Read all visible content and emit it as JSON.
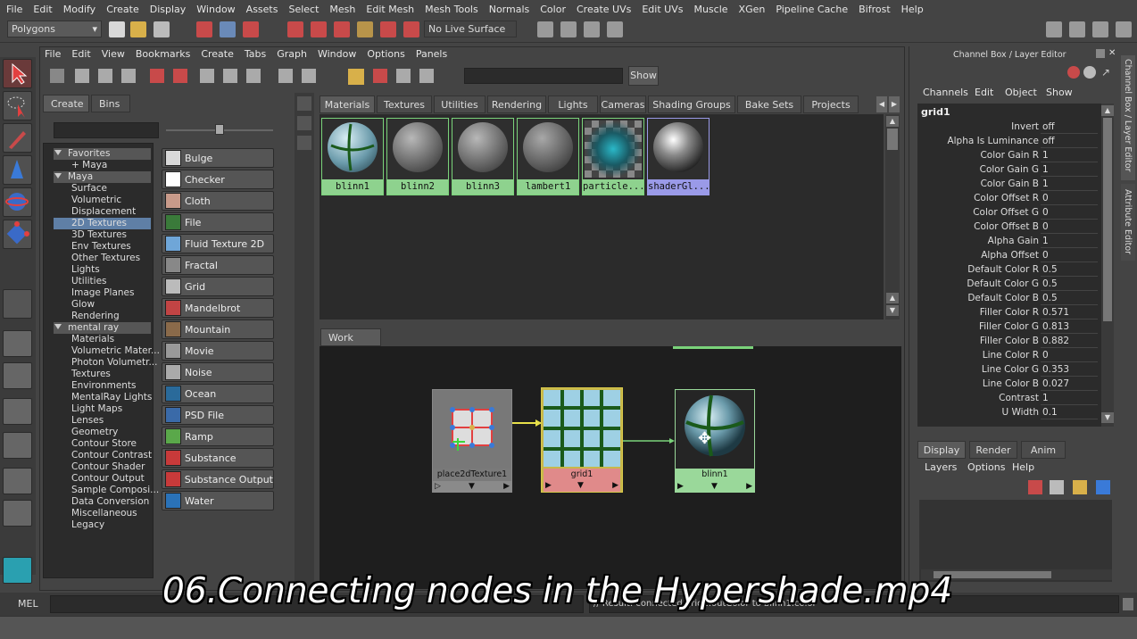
{
  "menubar": [
    "File",
    "Edit",
    "Modify",
    "Create",
    "Display",
    "Window",
    "Assets",
    "Select",
    "Mesh",
    "Edit Mesh",
    "Mesh Tools",
    "Normals",
    "Color",
    "Create UVs",
    "Edit UVs",
    "Muscle",
    "XGen",
    "Pipeline Cache",
    "Bifrost",
    "Help"
  ],
  "shelf": {
    "mode": "Polygons",
    "live_surface": "No Live Surface"
  },
  "hypershade": {
    "menu": [
      "File",
      "Edit",
      "View",
      "Bookmarks",
      "Create",
      "Tabs",
      "Graph",
      "Window",
      "Options",
      "Panels"
    ],
    "show_button": "Show",
    "left_tabs": [
      "Create",
      "Bins"
    ],
    "categories": [
      {
        "label": "Favorites",
        "kind": "h"
      },
      {
        "label": "+ Maya",
        "kind": "sub"
      },
      {
        "label": "Maya",
        "kind": "h"
      },
      {
        "label": "Surface",
        "kind": "sub"
      },
      {
        "label": "Volumetric",
        "kind": "sub"
      },
      {
        "label": "Displacement",
        "kind": "sub"
      },
      {
        "label": "2D Textures",
        "kind": "sel"
      },
      {
        "label": "3D Textures",
        "kind": "sub"
      },
      {
        "label": "Env Textures",
        "kind": "sub"
      },
      {
        "label": "Other Textures",
        "kind": "sub"
      },
      {
        "label": "Lights",
        "kind": "sub"
      },
      {
        "label": "Utilities",
        "kind": "sub"
      },
      {
        "label": "Image Planes",
        "kind": "sub"
      },
      {
        "label": "Glow",
        "kind": "sub"
      },
      {
        "label": "Rendering",
        "kind": "sub"
      },
      {
        "label": "mental ray",
        "kind": "h"
      },
      {
        "label": "Materials",
        "kind": "sub"
      },
      {
        "label": "Volumetric Mater...",
        "kind": "sub"
      },
      {
        "label": "Photon Volumetr...",
        "kind": "sub"
      },
      {
        "label": "Textures",
        "kind": "sub"
      },
      {
        "label": "Environments",
        "kind": "sub"
      },
      {
        "label": "MentalRay Lights",
        "kind": "sub"
      },
      {
        "label": "Light Maps",
        "kind": "sub"
      },
      {
        "label": "Lenses",
        "kind": "sub"
      },
      {
        "label": "Geometry",
        "kind": "sub"
      },
      {
        "label": "Contour Store",
        "kind": "sub"
      },
      {
        "label": "Contour Contrast",
        "kind": "sub"
      },
      {
        "label": "Contour Shader",
        "kind": "sub"
      },
      {
        "label": "Contour Output",
        "kind": "sub"
      },
      {
        "label": "Sample Composi...",
        "kind": "sub"
      },
      {
        "label": "Data Conversion",
        "kind": "sub"
      },
      {
        "label": "Miscellaneous",
        "kind": "sub"
      },
      {
        "label": "Legacy",
        "kind": "sub"
      }
    ],
    "textures": [
      {
        "label": "Bulge",
        "color": "#d8d8d8"
      },
      {
        "label": "Checker",
        "color": "#ffffff"
      },
      {
        "label": "Cloth",
        "color": "#c89a8a"
      },
      {
        "label": "File",
        "color": "#3a7a3a"
      },
      {
        "label": "Fluid Texture 2D",
        "color": "#6fa6d8"
      },
      {
        "label": "Fractal",
        "color": "#888888"
      },
      {
        "label": "Grid",
        "color": "#bbbbbb"
      },
      {
        "label": "Mandelbrot",
        "color": "#c24444"
      },
      {
        "label": "Mountain",
        "color": "#8a6a4a"
      },
      {
        "label": "Movie",
        "color": "#999999"
      },
      {
        "label": "Noise",
        "color": "#aaaaaa"
      },
      {
        "label": "Ocean",
        "color": "#2a6a9a"
      },
      {
        "label": "PSD File",
        "color": "#3a6aa8"
      },
      {
        "label": "Ramp",
        "color": "#5aa84a"
      },
      {
        "label": "Substance",
        "color": "#c83a3a"
      },
      {
        "label": "Substance Output",
        "color": "#c83a3a"
      },
      {
        "label": "Water",
        "color": "#2a72b8"
      }
    ],
    "top_tabs": [
      "Materials",
      "Textures",
      "Utilities",
      "Rendering",
      "Lights",
      "Cameras",
      "Shading Groups",
      "Bake Sets",
      "Projects"
    ],
    "swatches": [
      "blinn1",
      "blinn2",
      "blinn3",
      "lambert1",
      "particle...",
      "shaderGl..."
    ],
    "work_area_tab": "Work Area",
    "nodes": {
      "place": "place2dTexture1",
      "grid": "grid1",
      "blinn": "blinn1"
    }
  },
  "channel_box": {
    "title": "Channel Box / Layer Editor",
    "menu": [
      "Channels",
      "Edit",
      "Object",
      "Show"
    ],
    "node": "grid1",
    "attrs": [
      {
        "name": "Invert",
        "value": "off"
      },
      {
        "name": "Alpha Is Luminance",
        "value": "off"
      },
      {
        "name": "Color Gain R",
        "value": "1"
      },
      {
        "name": "Color Gain G",
        "value": "1"
      },
      {
        "name": "Color Gain B",
        "value": "1"
      },
      {
        "name": "Color Offset R",
        "value": "0"
      },
      {
        "name": "Color Offset G",
        "value": "0"
      },
      {
        "name": "Color Offset B",
        "value": "0"
      },
      {
        "name": "Alpha Gain",
        "value": "1"
      },
      {
        "name": "Alpha Offset",
        "value": "0"
      },
      {
        "name": "Default Color R",
        "value": "0.5"
      },
      {
        "name": "Default Color G",
        "value": "0.5"
      },
      {
        "name": "Default Color B",
        "value": "0.5"
      },
      {
        "name": "Filler Color R",
        "value": "0.571"
      },
      {
        "name": "Filler Color G",
        "value": "0.813"
      },
      {
        "name": "Filler Color B",
        "value": "0.882"
      },
      {
        "name": "Line Color R",
        "value": "0"
      },
      {
        "name": "Line Color G",
        "value": "0.353"
      },
      {
        "name": "Line Color B",
        "value": "0.027"
      },
      {
        "name": "Contrast",
        "value": "1"
      },
      {
        "name": "U Width",
        "value": "0.1"
      }
    ],
    "layer_tabs": [
      "Display",
      "Render",
      "Anim"
    ],
    "layer_menu": [
      "Layers",
      "Options",
      "Help"
    ],
    "side_tabs": [
      "Channel Box / Layer Editor",
      "Attribute Editor"
    ]
  },
  "cmd": {
    "label": "MEL",
    "output": "// Result: connected grid1.outColor to blinn1.color"
  },
  "caption": "06.Connecting nodes in the Hypershade.mp4"
}
